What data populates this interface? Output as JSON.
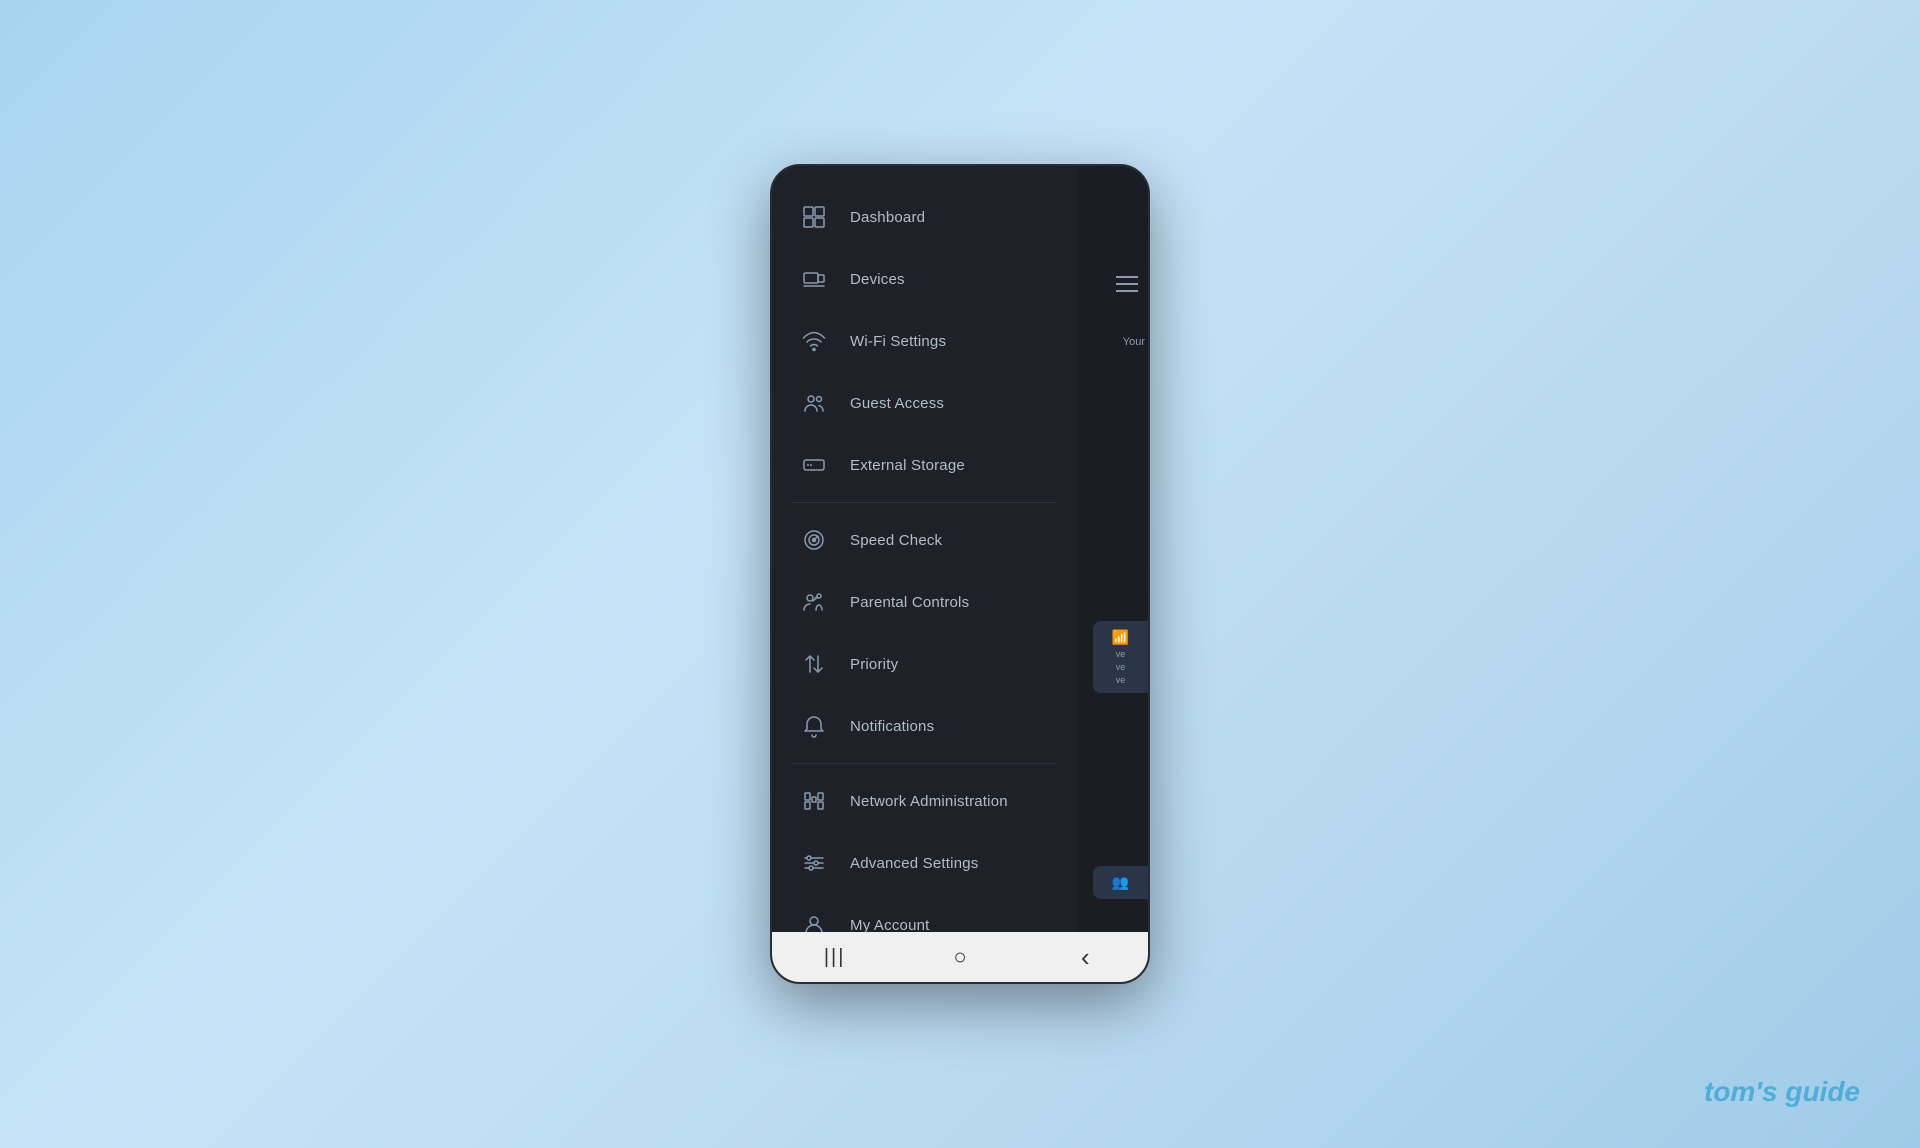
{
  "watermark": {
    "text": "tom's guide"
  },
  "nav": {
    "items_group1": [
      {
        "id": "dashboard",
        "label": "Dashboard",
        "icon": "dashboard"
      },
      {
        "id": "devices",
        "label": "Devices",
        "icon": "devices"
      },
      {
        "id": "wifi-settings",
        "label": "Wi-Fi Settings",
        "icon": "wifi"
      },
      {
        "id": "guest-access",
        "label": "Guest Access",
        "icon": "guest"
      },
      {
        "id": "external-storage",
        "label": "External Storage",
        "icon": "storage"
      }
    ],
    "items_group2": [
      {
        "id": "speed-check",
        "label": "Speed Check",
        "icon": "speedcheck"
      },
      {
        "id": "parental-controls",
        "label": "Parental Controls",
        "icon": "parental"
      },
      {
        "id": "priority",
        "label": "Priority",
        "icon": "priority"
      },
      {
        "id": "notifications",
        "label": "Notifications",
        "icon": "notifications"
      }
    ],
    "items_group3": [
      {
        "id": "network-administration",
        "label": "Network Administration",
        "icon": "networkadmin"
      },
      {
        "id": "advanced-settings",
        "label": "Advanced Settings",
        "icon": "advancedsettings"
      },
      {
        "id": "my-account",
        "label": "My Account",
        "icon": "account"
      }
    ]
  },
  "bottom_nav": {
    "bars_label": "|||",
    "home_label": "○",
    "back_label": "‹"
  },
  "bg": {
    "your_text": "Your",
    "ve_text_1": "ve",
    "ve_text_2": "ve",
    "ve_text_3": "ve"
  }
}
